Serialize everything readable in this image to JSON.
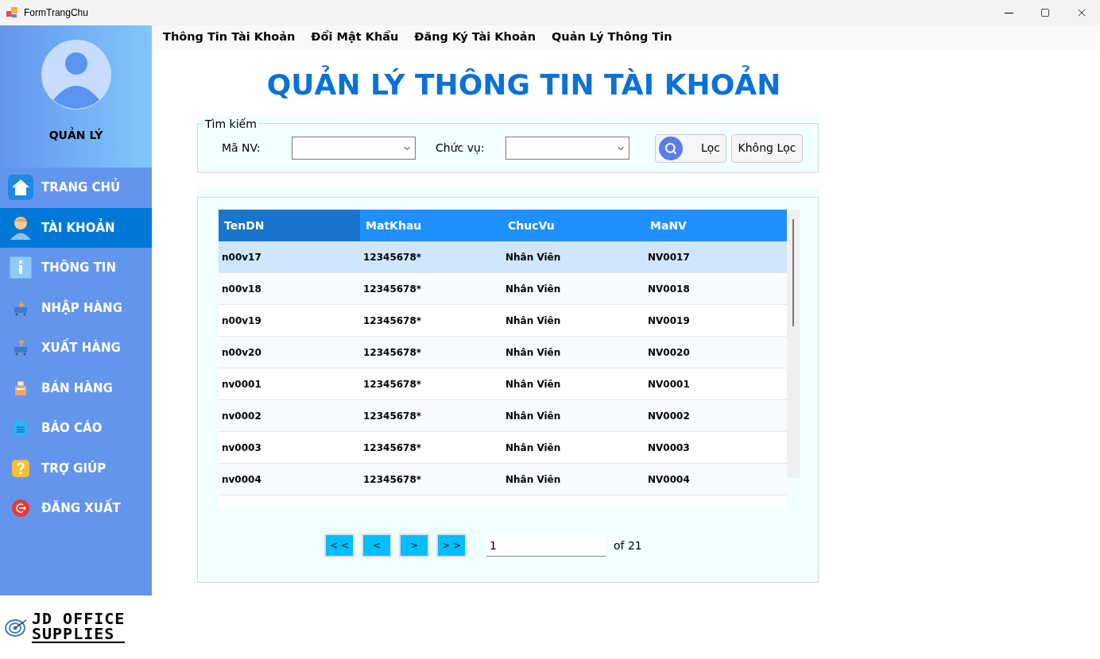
{
  "window": {
    "title": "FormTrangChu"
  },
  "sidebar": {
    "role": "QUẢN LÝ",
    "items": [
      {
        "label": "TRANG CHỦ",
        "selected": false
      },
      {
        "label": "TÀI KHOẢN",
        "selected": true
      },
      {
        "label": "THÔNG TIN",
        "selected": false
      },
      {
        "label": "NHẬP HÀNG",
        "selected": false
      },
      {
        "label": "XUẤT HÀNG",
        "selected": false
      },
      {
        "label": "BÁN HÀNG",
        "selected": false
      },
      {
        "label": "BÁO CÁO",
        "selected": false
      },
      {
        "label": "TRỢ GIÚP",
        "selected": false
      },
      {
        "label": "ĐĂNG XUẤT",
        "selected": false
      }
    ],
    "logo": [
      "JD OFFICE",
      "SUPPLIES"
    ]
  },
  "menu": [
    "Thông Tin Tài Khoản",
    "Đổi Mật Khẩu",
    "Đăng Ký Tài Khoản",
    "Quản Lý Thông Tin"
  ],
  "page_title": "QUẢN LÝ THÔNG TIN TÀI KHOẢN",
  "search": {
    "legend": "Tìm kiếm",
    "fields": [
      "Mã NV:",
      "Chức vụ:"
    ],
    "filter_button": "Lọc",
    "clear_button": "Không Lọc"
  },
  "table": {
    "columns": [
      {
        "label": "TenDN",
        "selected": true
      },
      {
        "label": "MatKhau",
        "selected": false
      },
      {
        "label": "ChucVu",
        "selected": false
      },
      {
        "label": "MaNV",
        "selected": false
      }
    ],
    "rows": [
      {
        "cells": [
          "n00v17",
          "12345678*",
          "Nhân Viên",
          "NV0017"
        ],
        "selected": true
      },
      {
        "cells": [
          "n00v18",
          "12345678*",
          "Nhân Viên",
          "NV0018"
        ],
        "selected": false
      },
      {
        "cells": [
          "n00v19",
          "12345678*",
          "Nhân Viên",
          "NV0019"
        ],
        "selected": false
      },
      {
        "cells": [
          "n00v20",
          "12345678*",
          "Nhân Viên",
          "NV0020"
        ],
        "selected": false
      },
      {
        "cells": [
          "nv0001",
          "12345678*",
          "Nhân Viên",
          "NV0001"
        ],
        "selected": false
      },
      {
        "cells": [
          "nv0002",
          "12345678*",
          "Nhân Viên",
          "NV0002"
        ],
        "selected": false
      },
      {
        "cells": [
          "nv0003",
          "12345678*",
          "Nhân Viên",
          "NV0003"
        ],
        "selected": false
      },
      {
        "cells": [
          "nv0004",
          "12345678*",
          "Nhân Viên",
          "NV0004"
        ],
        "selected": false
      }
    ]
  },
  "pager": {
    "buttons": [
      "< <",
      "<",
      ">",
      "> >"
    ],
    "page": "1",
    "total": "of 21"
  }
}
